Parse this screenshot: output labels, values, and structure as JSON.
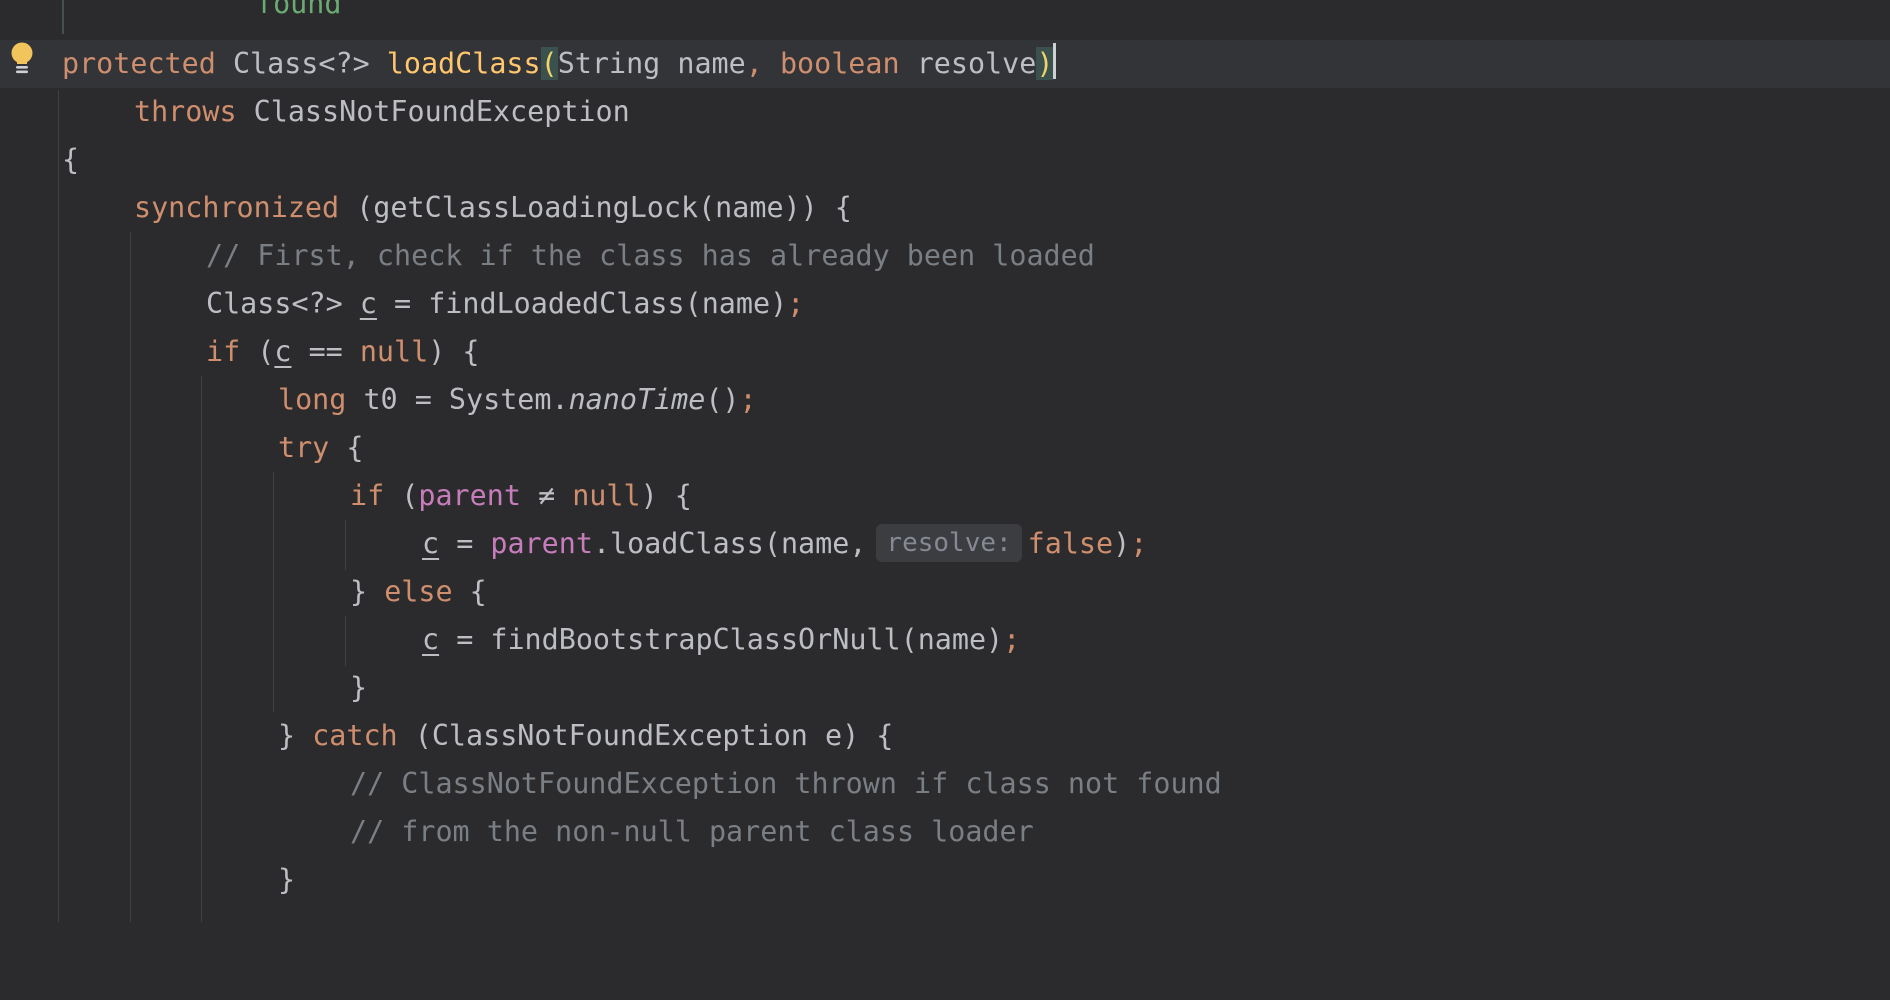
{
  "colors": {
    "background": "#2b2b2d",
    "current_line": "#323438",
    "keyword": "#cf8e6d",
    "field": "#c77dbb",
    "comment": "#7a7e85",
    "declaration": "#ffc66d",
    "text": "#bcbec4"
  },
  "gutter": {
    "intention_icon": "lightbulb-icon"
  },
  "lines": {
    "l0": {
      "text": "found"
    },
    "l1": {
      "kw1": "protected",
      "type": "Class<?>",
      "method": "loadClass",
      "p_open": "(",
      "p1_type": "String",
      "p1_name": "name",
      "comma": ",",
      "p2_type": "boolean",
      "p2_name": "resolve",
      "p_close": ")"
    },
    "l2": {
      "kw": "throws",
      "text": "ClassNotFoundException"
    },
    "l3": {
      "text": "{"
    },
    "l4": {
      "kw": "synchronized",
      "text": "(getClassLoadingLock(name)) {"
    },
    "l5": {
      "comment": "// First, check if the class has already been loaded"
    },
    "l6": {
      "type": "Class<?>",
      "var": "c",
      "rest": "= findLoadedClass(name)",
      "semi": ";"
    },
    "l7": {
      "kw": "if",
      "open": "(",
      "var": "c",
      "op": "==",
      "null": "null",
      "close": ") {"
    },
    "l8": {
      "kw": "long",
      "mid": "t0 = System.",
      "call": "nanoTime",
      "paren": "()",
      "semi": ";"
    },
    "l9": {
      "kw": "try",
      "rest": "{"
    },
    "l10": {
      "kw": "if",
      "open": "(",
      "field": "parent",
      "op": "≠",
      "null": "null",
      "close": ") {"
    },
    "l11": {
      "var": "c",
      "eq": "=",
      "field": "parent",
      "call": ".loadClass(name,",
      "hint": "resolve:",
      "val": "false",
      "end": ")",
      "semi": ";"
    },
    "l12": {
      "open": "}",
      "kw": "else",
      "close": "{"
    },
    "l13": {
      "var": "c",
      "rest": "= findBootstrapClassOrNull(name)",
      "semi": ";"
    },
    "l14": {
      "text": "}"
    },
    "l15": {
      "open": "}",
      "kw": "catch",
      "rest": "(ClassNotFoundException e) {"
    },
    "l16": {
      "comment": "// ClassNotFoundException thrown if class not found"
    },
    "l17": {
      "comment": "// from the non-null parent class loader"
    },
    "l18": {
      "text": "}"
    }
  }
}
